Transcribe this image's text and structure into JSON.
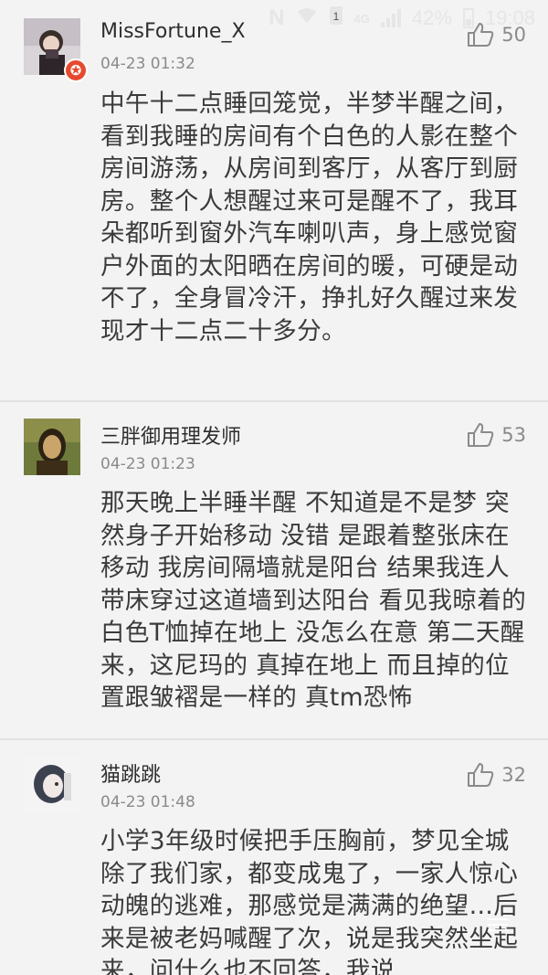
{
  "status_bar": {
    "carrier_icon": "N",
    "wifi_icon": "wifi-icon",
    "sim_icon": "sim-icon",
    "network": "4G",
    "battery": "42%",
    "time": "19:08"
  },
  "comments": [
    {
      "username": "MissFortune_X",
      "badge": "✪",
      "timestamp": "04-23 01:32",
      "likes": "50",
      "text": "中午十二点睡回笼觉，半梦半醒之间，看到我睡的房间有个白色的人影在整个房间游荡，从房间到客厅，从客厅到厨房。整个人想醒过来可是醒不了，我耳朵都听到窗外汽车喇叭声，身上感觉窗户外面的太阳晒在房间的暖，可硬是动不了，全身冒冷汗，挣扎好久醒过来发现才十二点二十多分。"
    },
    {
      "username": "三胖御用理发师",
      "timestamp": "04-23 01:23",
      "likes": "53",
      "text": "那天晚上半睡半醒 不知道是不是梦 突然身子开始移动 没错 是跟着整张床在移动 我房间隔墙就是阳台 结果我连人带床穿过这道墙到达阳台 看见我晾着的白色T恤掉在地上 没怎么在意 第二天醒来，这尼玛的 真掉在地上 而且掉的位置跟皱褶是一样的 真tm恐怖"
    },
    {
      "username": "猫跳跳",
      "timestamp": "04-23 01:48",
      "likes": "32",
      "text": "小学3年级时候把手压胸前，梦见全城除了我们家，都变成鬼了，一家人惊心动魄的逃难，那感觉是满满的绝望…后来是被老妈喊醒了次，说是我突然坐起来，问什么也不回答，我说"
    }
  ],
  "icons": {
    "like": "thumbs-up-icon",
    "badge": "vip-badge-icon"
  },
  "colors": {
    "background": "#f3f3f3",
    "text": "#3a3a3a",
    "meta": "#8a8a8a",
    "badge": "#e64a2e",
    "divider": "#e2e2e2"
  }
}
